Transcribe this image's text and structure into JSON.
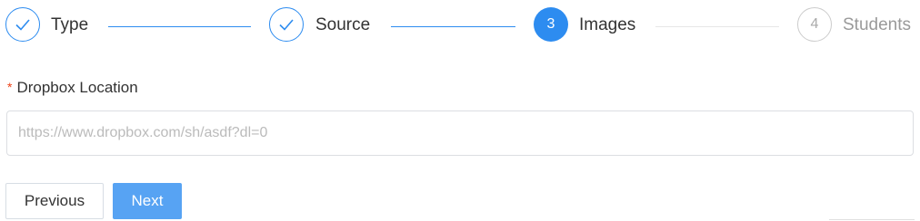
{
  "steps": [
    {
      "number": "",
      "label": "Type",
      "status": "finished",
      "icon": "check-icon"
    },
    {
      "number": "",
      "label": "Source",
      "status": "finished",
      "icon": "check-icon"
    },
    {
      "number": "3",
      "label": "Images",
      "status": "active"
    },
    {
      "number": "4",
      "label": "Students",
      "status": "wait"
    }
  ],
  "form": {
    "required_marker": "*",
    "dropbox_label": "Dropbox Location",
    "dropbox_value": "",
    "dropbox_placeholder": "https://www.dropbox.com/sh/asdf?dl=0"
  },
  "buttons": {
    "previous": "Previous",
    "next": "Next"
  },
  "colors": {
    "accent": "#2d8cf0",
    "primary_button": "#57a3f3",
    "required": "#ed3f14",
    "inactive": "#cccccc"
  }
}
